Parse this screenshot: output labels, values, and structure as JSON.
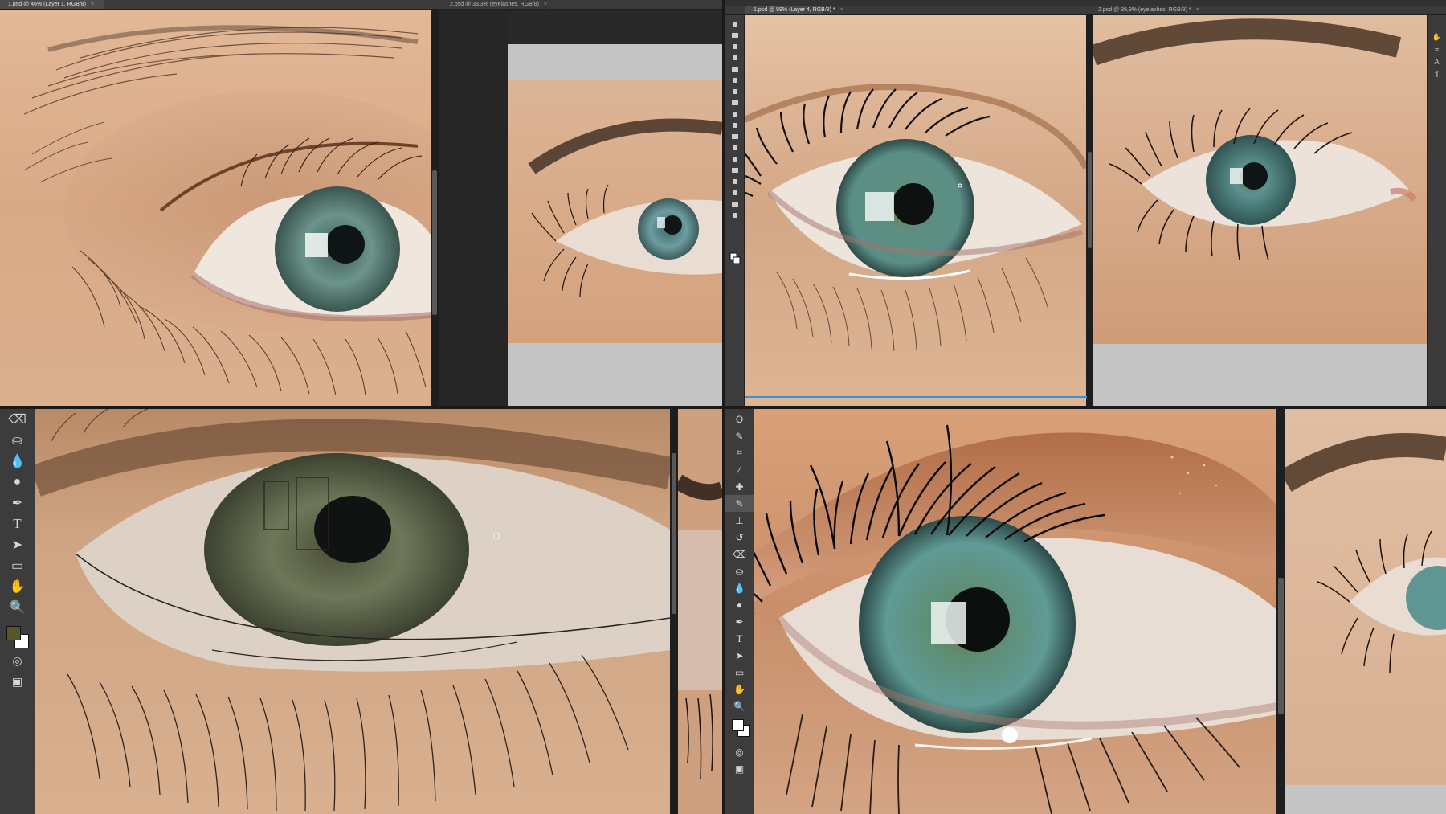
{
  "q1": {
    "tabs": [
      {
        "label": "1.psd @ 46% (Layer 1, RGB/8)",
        "close": "×"
      },
      {
        "label": "2.psd @ 33.3% (eyelashes, RGB/8)",
        "close": "×"
      }
    ]
  },
  "q2": {
    "tabs": [
      {
        "label": "1.psd @ 59% (Layer 4, RGB/8) *",
        "close": "×"
      },
      {
        "label": "2.psd @ 39,9% (eyelashes, RGB/8) *",
        "close": "×"
      }
    ],
    "right_panel": [
      "hand-icon",
      "paths-icon",
      "A",
      "paragraph-icon"
    ]
  },
  "q3": {
    "tools": [
      "eraser-icon",
      "paint-bucket-icon",
      "blur-icon",
      "sponge-icon",
      "pen-icon",
      "T",
      "path-select-icon",
      "rectangle-icon",
      "hand-icon",
      "zoom-icon"
    ],
    "foreground": "#57552a",
    "background": "#ffffff"
  },
  "q4": {
    "tools": [
      "lasso-icon",
      "quick-select-icon",
      "crop-icon",
      "eyedropper-icon",
      "healing-icon",
      "brush-icon",
      "stamp-icon",
      "history-brush-icon",
      "eraser-icon",
      "paint-bucket-icon",
      "blur-icon",
      "sponge-icon",
      "pen-icon",
      "T",
      "path-select-icon",
      "rectangle-icon",
      "hand-icon",
      "zoom-icon"
    ],
    "foreground": "#ffffff",
    "background": "#ffffff"
  },
  "colors": {
    "skin": "#dcb08c",
    "iris": "#5e8c86",
    "panel": "#3c3c3c"
  }
}
